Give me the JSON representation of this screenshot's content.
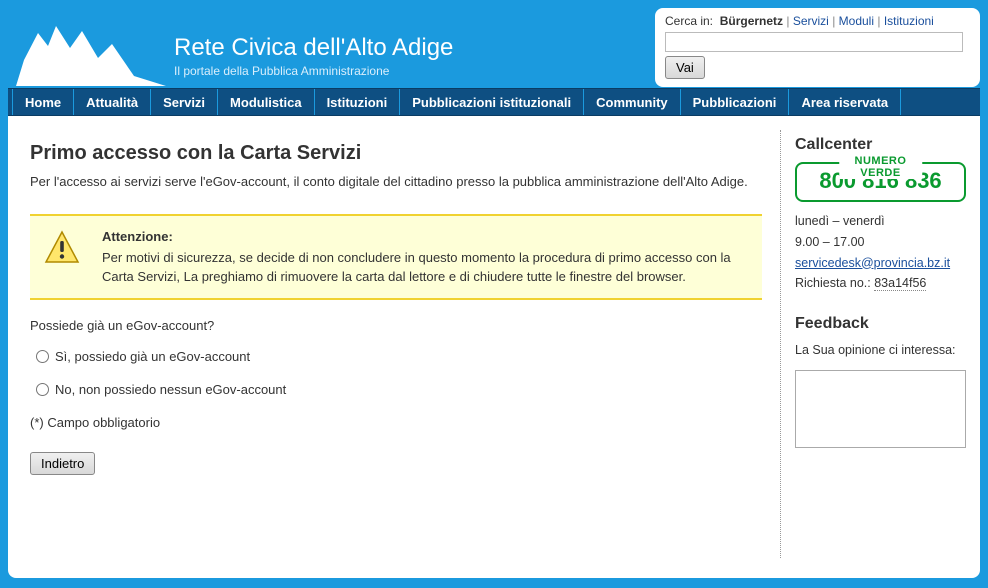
{
  "brand": {
    "title": "Rete Civica dell'Alto Adige",
    "subtitle": "Il portale della Pubblica Amministrazione"
  },
  "search": {
    "label_prefix": "Cerca in:",
    "current": "Bürgernetz",
    "links": [
      "Servizi",
      "Moduli",
      "Istituzioni"
    ],
    "button": "Vai"
  },
  "nav": [
    "Home",
    "Attualità",
    "Servizi",
    "Modulistica",
    "Istituzioni",
    "Pubblicazioni istituzionali",
    "Community",
    "Pubblicazioni",
    "Area riservata"
  ],
  "main": {
    "title": "Primo accesso con la Carta Servizi",
    "lead": "Per l'accesso ai servizi serve l'eGov-account, il conto digitale del cittadino presso la pubblica amministrazione dell'Alto Adige.",
    "alert_title": "Attenzione:",
    "alert_body": "Per motivi di sicurezza, se decide di non concludere in questo momento la procedura di primo accesso con la Carta Servizi, La preghiamo di rimuovere la carta dal lettore e di chiudere tutte le finestre del browser.",
    "question": "Possiede già un eGov-account?",
    "option_yes": "Sì, possiedo già un eGov-account",
    "option_no": "No, non possiedo nessun eGov-account",
    "required_note": "(*) Campo obbligatorio",
    "back_button": "Indietro"
  },
  "sidebar": {
    "callcenter_title": "Callcenter",
    "green_tag": "NUMERO VERDE",
    "green_number": "800 816 836",
    "hours": "lunedì – venerdì",
    "hours2": "9.00 – 17.00",
    "email": "servicedesk@provincia.bz.it",
    "request_label": "Richiesta no.:",
    "request_no": "83a14f56",
    "feedback_title": "Feedback",
    "feedback_prompt": "La Sua opinione ci interessa:"
  }
}
